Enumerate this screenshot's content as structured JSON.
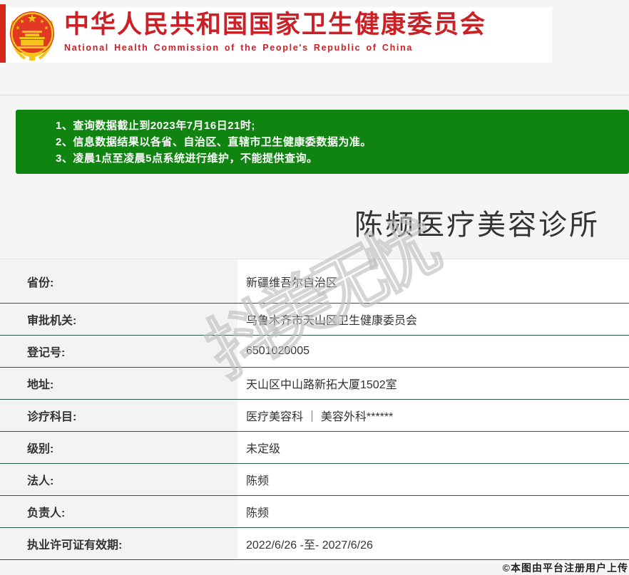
{
  "header": {
    "title_cn": "中华人民共和国国家卫生健康委员会",
    "title_en": "National Health Commission of the People's Republic of China"
  },
  "notice": {
    "lines": [
      "1、查询数据截止到2023年7月16日21时;",
      "2、信息数据结果以各省、自治区、直辖市卫生健康委数据为准。",
      "3、凌晨1点至凌晨5点系统进行维护，不能提供查询。"
    ]
  },
  "result": {
    "clinic_name": "陈频医疗美容诊所",
    "fields": [
      {
        "label": "省份:",
        "value": "新疆维吾尔自治区"
      },
      {
        "label": "审批机关:",
        "value": "乌鲁木齐市天山区卫生健康委员会"
      },
      {
        "label": "登记号:",
        "value": "6501020005"
      },
      {
        "label": "地址:",
        "value": "天山区中山路新拓大厦1502室"
      },
      {
        "label": "诊疗科目:",
        "value": "医疗美容科 ｜ 美容外科******"
      },
      {
        "label": "级别:",
        "value": "未定级"
      },
      {
        "label": "法人:",
        "value": "陈频"
      },
      {
        "label": "负责人:",
        "value": "陈频"
      },
      {
        "label": "执业许可证有效期:",
        "value": "2022/6/26 -至- 2027/6/26"
      }
    ]
  },
  "watermark_text": "抖美无忧",
  "footer": {
    "upload_credit": "©本图由平台注册用户上传"
  },
  "icons": {
    "emblem": "national-emblem-of-china"
  },
  "colors": {
    "brand_red": "#cb2026",
    "notice_green": "#108410",
    "row_divider": "#2f5a4b",
    "page_bg": "#f5f5f5",
    "label_cell_bg": "#f3f3f1"
  }
}
